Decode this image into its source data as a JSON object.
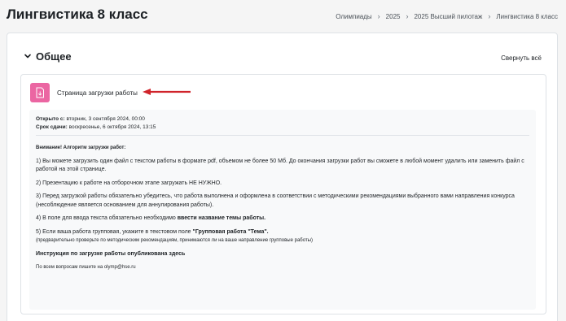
{
  "header": {
    "title": "Лингвистика 8 класс",
    "breadcrumb": [
      "Олимпиады",
      "2025",
      "2025 Высший пилотаж",
      "Лингвистика 8 класс"
    ]
  },
  "section": {
    "title": "Общее",
    "collapse_all": "Свернуть всё"
  },
  "activity": {
    "name": "Страница загрузки работы",
    "icon": "file-upload-icon",
    "icon_color": "#eb66a2",
    "opened_label": "Открыто с:",
    "opened_value": "вторник, 3 сентября 2024, 00:00",
    "due_label": "Срок сдачи:",
    "due_value": "воскресенье, 6 октября 2024, 13:15",
    "attention": "Внимание! Алгоритм загрузки работ:",
    "p1": "1) Вы можете загрузить один файл с текстом работы в формате pdf, объемом не более 50 Мб.  До окончания загрузки работ вы сможете в любой момент удалить или заменить файл с работой на этой странице.",
    "p2": "2) Презентацию к работе на отборочном этапе загружать НЕ НУЖНО.",
    "p3": "3) Перед загрузкой работы обязательно убедитесь, что работа выполнена и оформлена в соответствии с методическими рекомендациями выбранного вами направления конкурса (несоблюдение является основанием для аннулирования работы).",
    "p4_pre": "4) В поле для ввода текста обязательно необходимо ",
    "p4_bold": "ввести название темы работы.",
    "p5_pre": "5) Если ваша работа групповая, укажите в текстовом поле ",
    "p5_bold": "\"Групповая работа \"Тема\".",
    "p5_note": "(предварительно  проверьте по  методическим рекомендациям, принимаются ли на ваше направление групповые работы)",
    "instruction": "Инструкция по загрузке работы опубликована здесь",
    "contact": "По всем вопросам пишите на olymp@hse.ru"
  },
  "colors": {
    "arrow": "#d0232a",
    "accent": "#eb66a2"
  }
}
